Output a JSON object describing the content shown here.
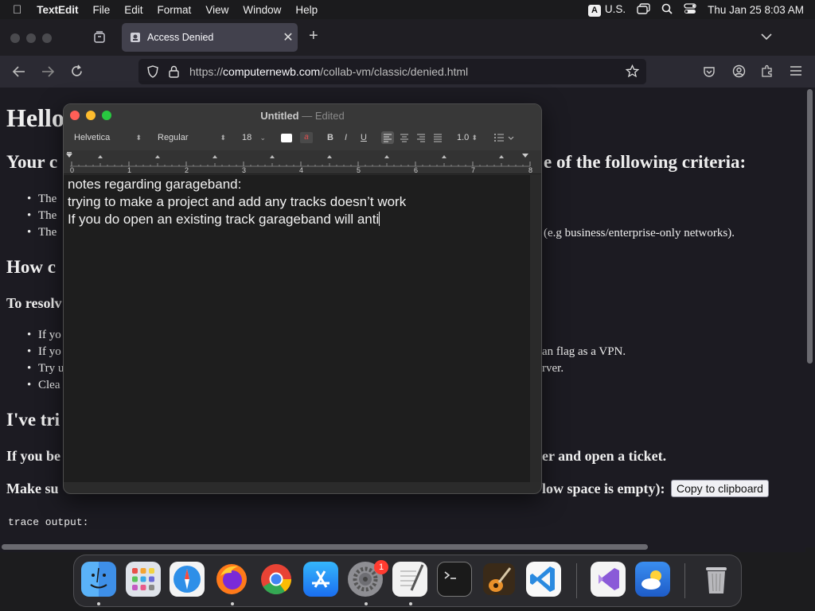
{
  "menubar": {
    "app_name": "TextEdit",
    "items": [
      "File",
      "Edit",
      "Format",
      "View",
      "Window",
      "Help"
    ],
    "input_source_badge": "A",
    "input_source": "U.S.",
    "datetime": "Thu Jan 25  8:03 AM"
  },
  "browser": {
    "tab_title": "Access Denied",
    "url_prefix": "https://",
    "url_domain": "computernewb.com",
    "url_path": "/collab-vm/classic/denied.html"
  },
  "webpage": {
    "heading": "Hello",
    "your_prefix": "Your c",
    "your_suffix": "e of the following criteria:",
    "bullet1": "The",
    "bullet2": "The",
    "bullet3": "The",
    "bullet3_tail": "(e.g business/enterprise-only networks).",
    "how_prefix": "How c",
    "resolve_prefix": "To resolv",
    "resolve_bullet1": "If yo",
    "resolve_bullet2": "If yo",
    "resolve_bullet2_tail": "an flag as a VPN.",
    "resolve_bullet3": "Try u",
    "resolve_bullet3_tail": "rver.",
    "resolve_bullet4": "Clea",
    "tried_prefix": "I've tri",
    "ifyou_prefix": "If you be",
    "ifyou_suffix": "er and open a ticket.",
    "make_prefix": "Make su",
    "make_suffix": "low space is empty):",
    "copy_button": "Copy to clipboard",
    "trace_label": "trace output:"
  },
  "textedit": {
    "title": "Untitled",
    "title_sep": "—",
    "title_status": "Edited",
    "font_family": "Helvetica",
    "font_style": "Regular",
    "font_size": "18",
    "line_spacing": "1.0",
    "bold": "B",
    "italic": "I",
    "underline": "U",
    "ruler_numbers": [
      "0",
      "1",
      "2",
      "3",
      "4",
      "5",
      "6",
      "7",
      "8"
    ],
    "lines": [
      "notes regarding garageband:",
      "trying to make a project and add any tracks doesn’t work",
      "If you do open an existing track garageband will anti"
    ]
  },
  "dock": {
    "apps": [
      "finder-icon",
      "launchpad-icon",
      "safari-icon",
      "firefox-icon",
      "chrome-icon",
      "app-store-icon",
      "system-settings-icon",
      "textedit-icon",
      "terminal-icon",
      "garageband-icon",
      "vscode-icon",
      "visual-studio-icon",
      "weather-icon",
      "trash-icon"
    ],
    "settings_badge": "1"
  },
  "colors": {
    "close": "#ff5f57",
    "minimize": "#febc2e",
    "zoom": "#28c840"
  }
}
